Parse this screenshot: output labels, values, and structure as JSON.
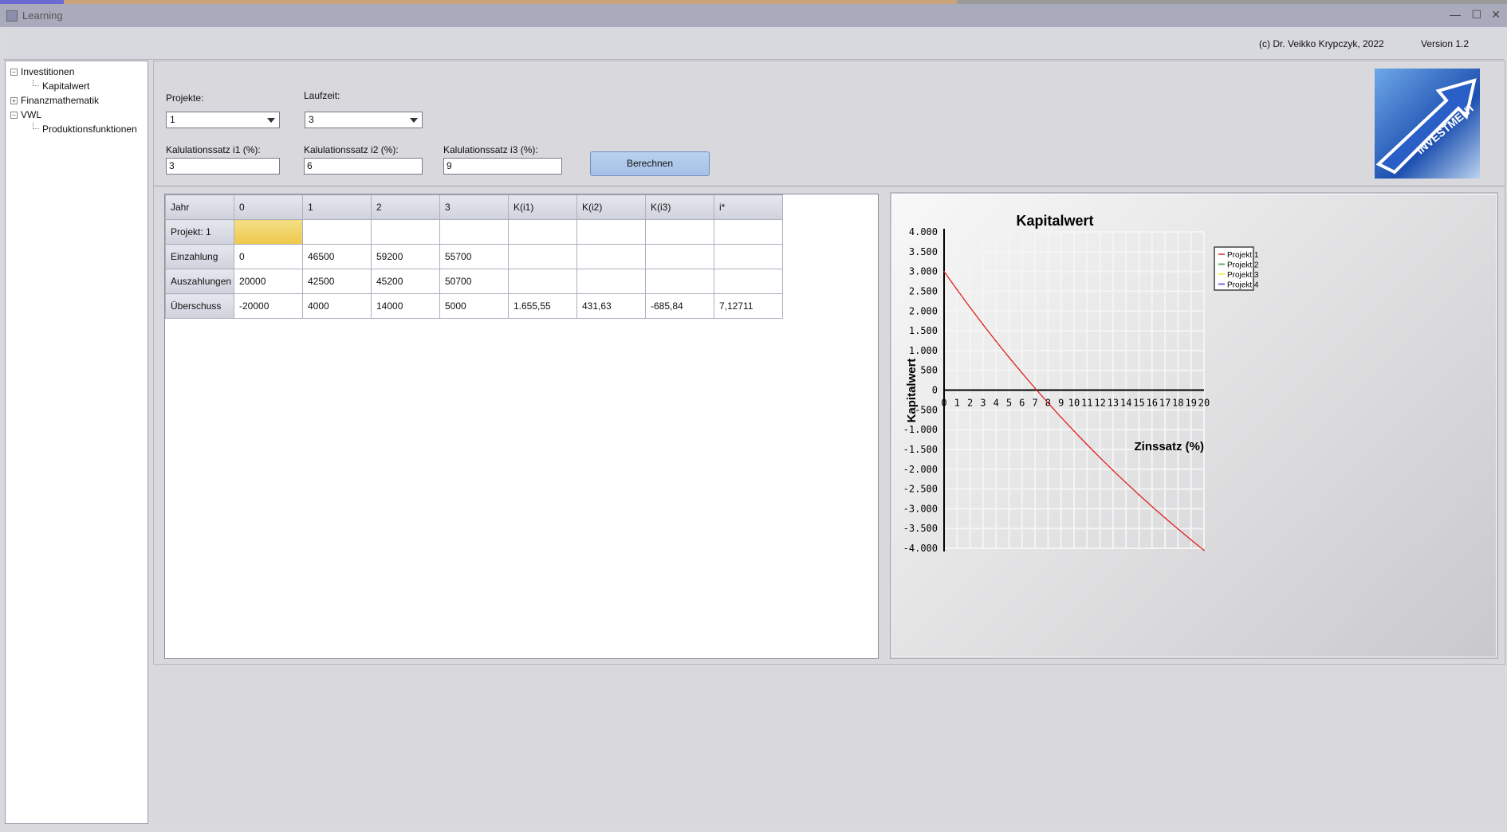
{
  "window": {
    "title": "Learning",
    "minimize": "—",
    "maximize": "☐",
    "close": "✕"
  },
  "header": {
    "copyright": "(c) Dr. Veikko Krypczyk, 2022",
    "version": "Version 1.2"
  },
  "tree": [
    {
      "label": "Investitionen",
      "toggle": "−",
      "level": 0
    },
    {
      "label": "Kapitalwert",
      "level": 1
    },
    {
      "label": "Finanzmathematik",
      "toggle": "+",
      "level": 0
    },
    {
      "label": "VWL",
      "toggle": "−",
      "level": 0
    },
    {
      "label": "Produktionsfunktionen",
      "level": 1
    }
  ],
  "form": {
    "projekte_label": "Projekte:",
    "projekte_value": "1",
    "laufzeit_label": "Laufzeit:",
    "laufzeit_value": "3",
    "i1_label": "Kalulationssatz i1 (%):",
    "i1_value": "3",
    "i2_label": "Kalulationssatz i2 (%):",
    "i2_value": "6",
    "i3_label": "Kalulationssatz i3 (%):",
    "i3_value": "9",
    "button": "Berechnen",
    "logo_text": "INVESTMENT"
  },
  "table": {
    "headers": [
      "Jahr",
      "0",
      "1",
      "2",
      "3",
      "K(i1)",
      "K(i2)",
      "K(i3)",
      "i*"
    ],
    "rows": [
      [
        "Projekt: 1",
        "",
        "",
        "",
        "",
        "",
        "",
        "",
        ""
      ],
      [
        "Einzahlung",
        "0",
        "46500",
        "59200",
        "55700",
        "",
        "",
        "",
        ""
      ],
      [
        "Auszahlungen",
        "20000",
        "42500",
        "45200",
        "50700",
        "",
        "",
        "",
        ""
      ],
      [
        "Überschuss",
        "-20000",
        "4000",
        "14000",
        "5000",
        "1.655,55",
        "431,63",
        "-685,84",
        "7,12711"
      ]
    ]
  },
  "chart_data": {
    "type": "line",
    "title": "Kapitalwert",
    "xlabel": "Zinssatz (%)",
    "ylabel": "Kapitalwert",
    "xlim": [
      0,
      20
    ],
    "ylim": [
      -4000,
      4000
    ],
    "xticks": [
      "0",
      "1",
      "2",
      "3",
      "4",
      "5",
      "6",
      "7",
      "8",
      "9",
      "10",
      "11",
      "12",
      "13",
      "14",
      "15",
      "16",
      "17",
      "18",
      "19",
      "20"
    ],
    "yticks": [
      "4.000",
      "3.500",
      "3.000",
      "2.500",
      "2.000",
      "1.500",
      "1.000",
      "500",
      "0",
      "-500",
      "-1.000",
      "-1.500",
      "-2.000",
      "-2.500",
      "-3.000",
      "-3.500",
      "-4.000"
    ],
    "grid": true,
    "legend_position": "top-right",
    "legend": [
      {
        "name": "Projekt 1",
        "color": "#e06060"
      },
      {
        "name": "Projekt 2",
        "color": "#60b060"
      },
      {
        "name": "Projekt 3",
        "color": "#f0f060"
      },
      {
        "name": "Projekt 4",
        "color": "#7070e0"
      }
    ],
    "series": [
      {
        "name": "Projekt 1",
        "color": "#e02020",
        "x": [
          0,
          1,
          2,
          3,
          4,
          5,
          6,
          7,
          8,
          9,
          10,
          11,
          12,
          13,
          14,
          15,
          16,
          17,
          18,
          19,
          20
        ],
        "values": [
          3000,
          2538,
          2090,
          1656,
          1235,
          827,
          432,
          48,
          -324,
          -686,
          -1037,
          -1378,
          -1709,
          -2031,
          -2344,
          -2648,
          -2944,
          -3232,
          -3512,
          -3785,
          -4051
        ]
      }
    ]
  }
}
